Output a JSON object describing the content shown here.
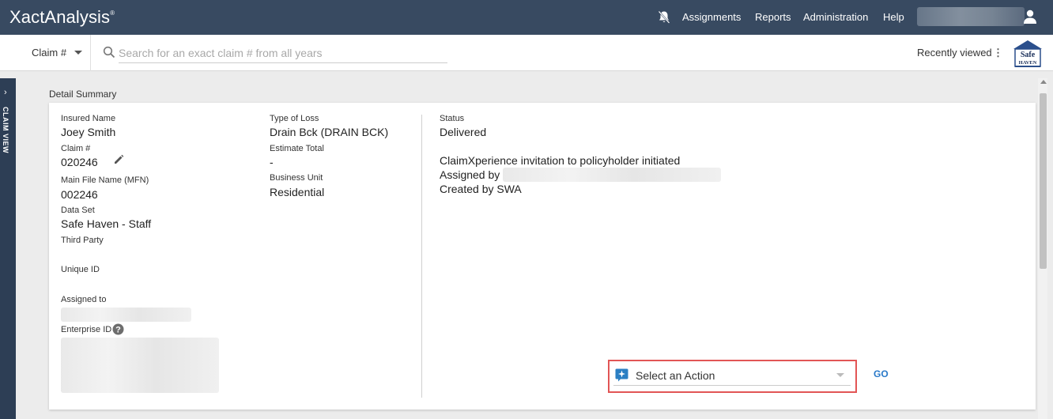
{
  "app": {
    "brand": "XactAnalysis",
    "brand_mark": "®"
  },
  "nav": {
    "items": [
      "Assignments",
      "Reports",
      "Administration",
      "Help"
    ]
  },
  "search": {
    "filter_label": "Claim #",
    "placeholder": "Search for an exact claim # from all years",
    "recently_viewed": "Recently viewed",
    "logo_text_top": "Safe",
    "logo_text_bottom": "HAVEN"
  },
  "side_tab": {
    "label": "CLAIM VIEW"
  },
  "detail": {
    "section_title": "Detail Summary",
    "col1": {
      "insured_name_label": "Insured Name",
      "insured_name": "Joey Smith",
      "claim_label": "Claim #",
      "claim": "020246",
      "mfn_label": "Main File Name (MFN)",
      "mfn": "002246",
      "dataset_label": "Data Set",
      "dataset": "Safe Haven - Staff",
      "third_party_label": "Third Party",
      "unique_id_label": "Unique ID",
      "assigned_to_label": "Assigned to",
      "enterprise_id_label": "Enterprise ID"
    },
    "col2": {
      "type_of_loss_label": "Type of Loss",
      "type_of_loss": "Drain Bck (DRAIN BCK)",
      "estimate_total_label": "Estimate Total",
      "estimate_total": "-",
      "business_unit_label": "Business Unit",
      "business_unit": "Residential"
    },
    "col3": {
      "status_label": "Status",
      "status": "Delivered",
      "note_line1": "ClaimXperience invitation to policyholder initiated",
      "note_line2": "Assigned by",
      "note_line3": "Created by SWA"
    },
    "action": {
      "label": "Select an Action",
      "go": "GO"
    }
  },
  "colors": {
    "topbar": "#384a61",
    "sidetab": "#2d3e55",
    "highlight": "#e25555",
    "link": "#2979c9",
    "action_icon": "#2b7fc3"
  }
}
